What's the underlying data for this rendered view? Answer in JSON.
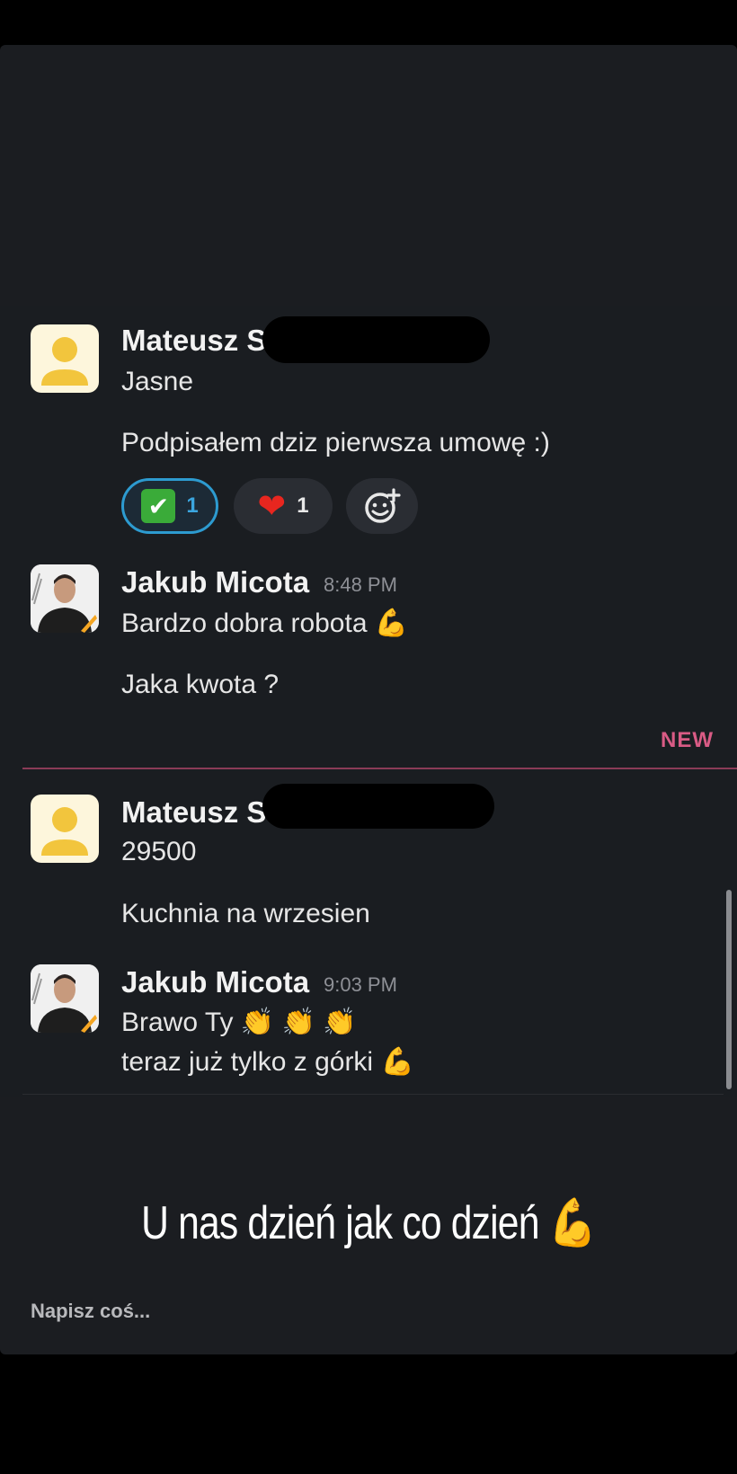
{
  "messages": [
    {
      "author": "Mateusz S",
      "lines": [
        "Jasne",
        "Podpisałem dziz pierwsza umowę :)"
      ],
      "reactions": [
        {
          "emoji": "check-mark-button",
          "count": "1",
          "active": true
        },
        {
          "emoji": "red-heart",
          "count": "1",
          "active": false
        },
        {
          "emoji": "add-reaction-icon"
        }
      ]
    },
    {
      "author": "Jakub Micota",
      "time": "8:48 PM",
      "lines": [
        "Bardzo dobra robota",
        "Jaka kwota ?"
      ]
    },
    {
      "author": "Mateusz S",
      "lines": [
        "29500",
        "Kuchnia na wrzesien"
      ]
    },
    {
      "author": "Jakub Micota",
      "time": "9:03 PM",
      "lines": [
        "Brawo Ty",
        "teraz już tylko z górki"
      ]
    }
  ],
  "divider": {
    "new_label": "NEW"
  },
  "caption": "U nas dzień jak co dzień",
  "composer": {
    "placeholder": "Napisz coś..."
  },
  "emojis": {
    "flexed_biceps": "💪",
    "clapping_hands": "👏",
    "check_mark": "✔",
    "heart": "❤"
  },
  "colors": {
    "accent_blue": "#2d9bd0",
    "new_pink": "#d95b85",
    "panel_bg": "#1b1d21"
  }
}
